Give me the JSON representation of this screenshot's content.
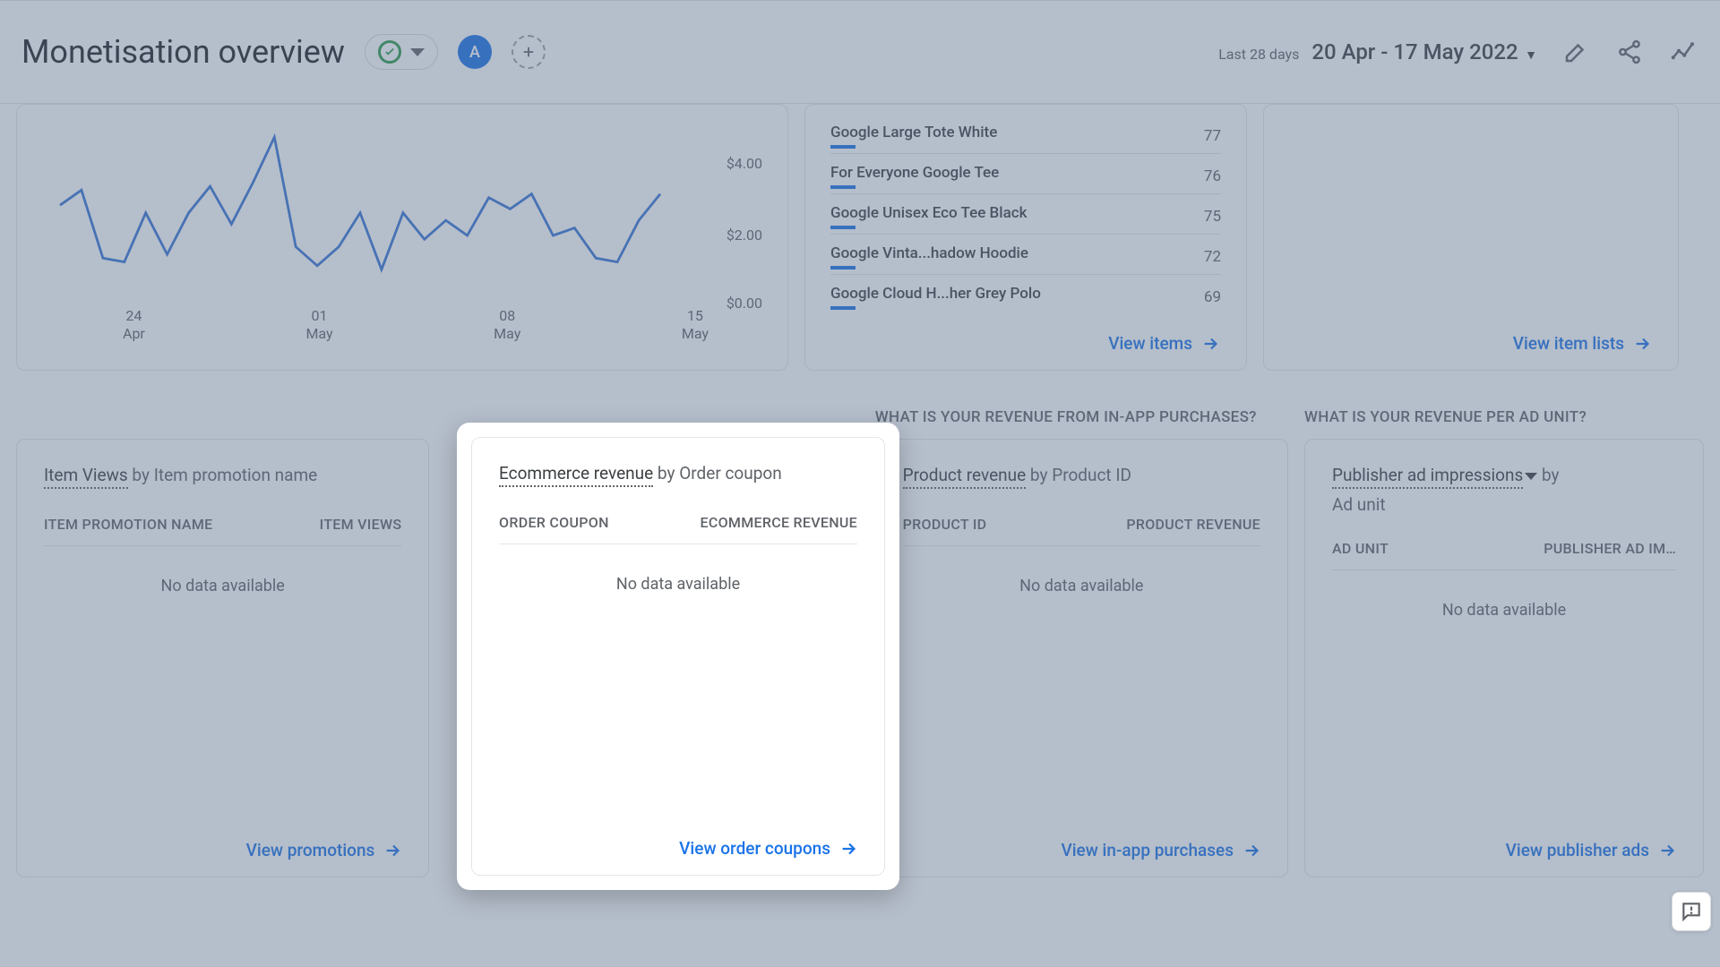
{
  "header": {
    "title": "Monetisation overview",
    "avatar_letter": "A",
    "date_small": "Last 28 days",
    "date_range": "20 Apr - 17 May 2022"
  },
  "chart_data": {
    "type": "line",
    "title": "",
    "xlabel": "",
    "ylabel": "",
    "yticks": [
      "$4.00",
      "$2.00",
      "$0.00"
    ],
    "ylim": [
      0,
      4.5
    ],
    "categories": [
      "24 Apr",
      "01 May",
      "08 May",
      "15 May"
    ],
    "x": [
      19,
      20,
      21,
      22,
      23,
      24,
      25,
      26,
      27,
      28,
      29,
      30,
      1,
      2,
      3,
      4,
      5,
      6,
      7,
      8,
      9,
      10,
      11,
      12,
      13,
      14,
      15,
      16,
      17
    ],
    "values": [
      2.6,
      3.0,
      1.2,
      1.1,
      2.4,
      1.3,
      2.4,
      3.1,
      2.1,
      3.2,
      4.4,
      1.5,
      1.0,
      1.5,
      2.4,
      0.9,
      2.4,
      1.7,
      2.2,
      1.8,
      2.8,
      2.5,
      2.9,
      1.8,
      2.0,
      1.2,
      1.1,
      2.2,
      2.9
    ]
  },
  "items_table": {
    "rows": [
      {
        "name": "Google Large Tote White",
        "value": "77"
      },
      {
        "name": "For Everyone Google Tee",
        "value": "76"
      },
      {
        "name": "Google Unisex Eco Tee Black",
        "value": "75"
      },
      {
        "name": "Google Vinta...hadow Hoodie",
        "value": "72"
      },
      {
        "name": "Google Cloud H...her Grey Polo",
        "value": "69"
      }
    ],
    "footer_link": "View items"
  },
  "item_lists_link": "View item lists",
  "section_headings": {
    "in_app": "WHAT IS YOUR REVENUE FROM IN-APP PURCHASES?",
    "ad_unit": "WHAT IS YOUR REVENUE PER AD UNIT?"
  },
  "cards": {
    "promotions": {
      "metric": "Item Views",
      "by": " by Item promotion name",
      "col1": "ITEM PROMOTION NAME",
      "col2": "ITEM VIEWS",
      "no_data": "No data available",
      "link": "View promotions"
    },
    "coupons": {
      "metric": "Ecommerce revenue",
      "by": " by Order coupon",
      "col1": "ORDER COUPON",
      "col2": "ECOMMERCE REVENUE",
      "no_data": "No data available",
      "link": "View order coupons"
    },
    "product": {
      "metric": "Product revenue",
      "by": " by Product ID",
      "col1": "PRODUCT ID",
      "col2": "PRODUCT REVENUE",
      "no_data": "No data available",
      "link": "View in-app purchases"
    },
    "publisher": {
      "metric": "Publisher ad impressions",
      "by2a": " by",
      "by2b": "Ad unit",
      "col1": "AD UNIT",
      "col2": "PUBLISHER AD IM…",
      "no_data": "No data available",
      "link": "View publisher ads"
    }
  }
}
